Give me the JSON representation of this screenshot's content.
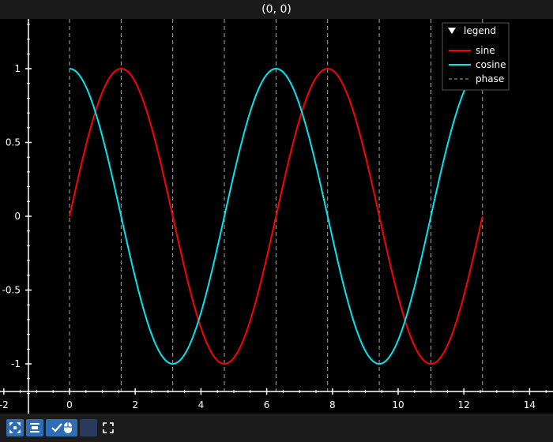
{
  "window": {
    "coord_readout": "(0, 0)"
  },
  "legend": {
    "title": "legend",
    "entries": [
      {
        "label": "sine",
        "color": "#ff0000",
        "style": "solid"
      },
      {
        "label": "cosine",
        "color": "#00e5ee",
        "style": "solid"
      },
      {
        "label": "phase",
        "color": "#aaaaaa",
        "style": "dashed"
      }
    ]
  },
  "toolbar": {
    "buttons": [
      {
        "icon": "fit-view-icon"
      },
      {
        "icon": "align-icon"
      },
      {
        "icon": "mouse-mode-icon"
      },
      {
        "icon": "blank-toggle-icon"
      },
      {
        "icon": "fullscreen-icon"
      }
    ]
  },
  "chart_data": {
    "type": "line",
    "title": "",
    "xlabel": "",
    "ylabel": "",
    "xlim": [
      -2,
      14.7
    ],
    "ylim": [
      -1.2,
      1.3
    ],
    "x_ticks": [
      -2,
      0,
      2,
      4,
      6,
      8,
      10,
      12,
      14
    ],
    "y_ticks": [
      1,
      0.5,
      0,
      -0.5,
      -1
    ],
    "x_tick_labels": [
      "-2",
      "0",
      "2",
      "4",
      "6",
      "8",
      "10",
      "12",
      "14"
    ],
    "y_tick_labels": [
      "1",
      "0.5",
      "0",
      "-0.5",
      "-1"
    ],
    "x_range": [
      0,
      12.566
    ],
    "series": [
      {
        "name": "sine",
        "function": "sin",
        "color": "#ff0000"
      },
      {
        "name": "cosine",
        "function": "cos",
        "color": "#00e5ee"
      }
    ],
    "phase_lines": [
      0,
      1.5708,
      3.1416,
      4.7124,
      6.2832,
      7.854,
      9.4248,
      10.9956,
      12.5664
    ],
    "phase_name": "phase",
    "grid": false,
    "legend_position": "top-right"
  }
}
